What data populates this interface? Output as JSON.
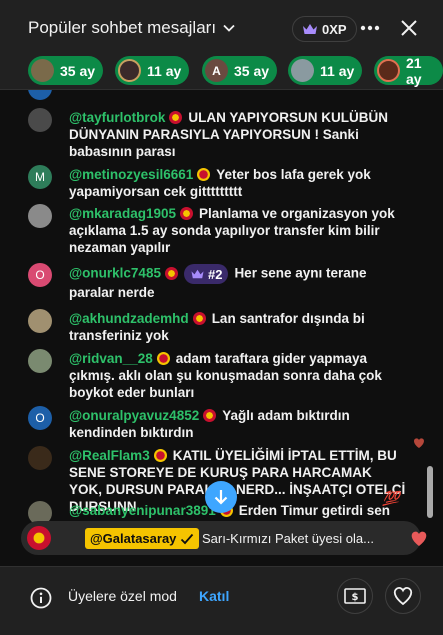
{
  "header": {
    "title": "Popüler sohbet mesajları",
    "xp": "0XP"
  },
  "tickers": [
    {
      "label": "35 ay",
      "avatar_color": "#7a6a4a"
    },
    {
      "label": "11 ay",
      "avatar_color": "#3a2a2a"
    },
    {
      "label": "35 ay",
      "avatar_color": "#6a4a40",
      "avatar_letter": "A"
    },
    {
      "label": "11 ay",
      "avatar_color": "#8a9aa0"
    },
    {
      "label": "21 ay",
      "avatar_color": "#5a2a1a"
    }
  ],
  "messages": [
    {
      "author": "@tayfurlotbrok",
      "text": "ULAN YAPIYORSUN KULÜBÜN DÜNYANIN PARASIYLA YAPIYORSUN ! Sanki babasının parası",
      "avatar_color": "#4a4a4a",
      "badge": "gs"
    },
    {
      "author": "@metinozyesil6661",
      "text": "Yeter bos lafa gerek yok yapamiyorsan cek gittttttttt",
      "avatar_color": "#2e7d5a",
      "avatar_letter": "M",
      "badge": "red"
    },
    {
      "author": "@mkaradag1905",
      "text": "Planlama ve organizasyon yok açıklama 1.5 ay sonda yapılıyor transfer kim bilir nezaman yapılır",
      "avatar_color": "#8a8a8a",
      "badge": "gs"
    },
    {
      "author": "@onurklc7485",
      "text": "Her sene aynı terane paralar nerde",
      "avatar_color": "#d94a72",
      "avatar_letter": "O",
      "badge": "gs",
      "rank": "#2"
    },
    {
      "author": "@akhundzademhd",
      "text": "Lan santrafor dışında bi transferiniz yok",
      "avatar_color": "#a09070",
      "badge": "gs"
    },
    {
      "author": "@ridvan__28",
      "text": "adam taraftara gider yapmaya çıkmış. aklı olan şu konuşmadan sonra daha çok boykot eder bunları",
      "avatar_color": "#7a8a70",
      "badge": "red"
    },
    {
      "author": "@onuralpyavuz4852",
      "text": "Yağlı adam bıktırdın kendinden bıktırdın",
      "avatar_color": "#1d5fa8",
      "avatar_letter": "O",
      "badge": "gs"
    },
    {
      "author": "@RealFlam3",
      "text": "KATIL ÜYELİĞİMİ İPTAL ETTİM, BU SENE STOREYE DE KURUŞ PARA HARCAMAK YOK, DURSUN PARALAR NERD... İNŞAATÇI OTELCİ DURSUNN",
      "avatar_color": "#3a2a1a",
      "badge": "red"
    },
    {
      "author": "@sabanyenipunar3891",
      "text": "Erden Timur getirdi sen",
      "avatar_color": "#6a6a5a",
      "badge": "red"
    }
  ],
  "banner": {
    "handle": "@Galatasaray",
    "text": "Sarı-Kırmızı Paket üyesi ola..."
  },
  "footer": {
    "mode": "Üyelere özel mod",
    "join": "Katıl"
  },
  "colors": {
    "accent_green": "#0c8a47",
    "author_green": "#2ec16a",
    "link_blue": "#3ea6ff",
    "gs_yellow": "#f5c400",
    "gs_red": "#c8102e"
  }
}
